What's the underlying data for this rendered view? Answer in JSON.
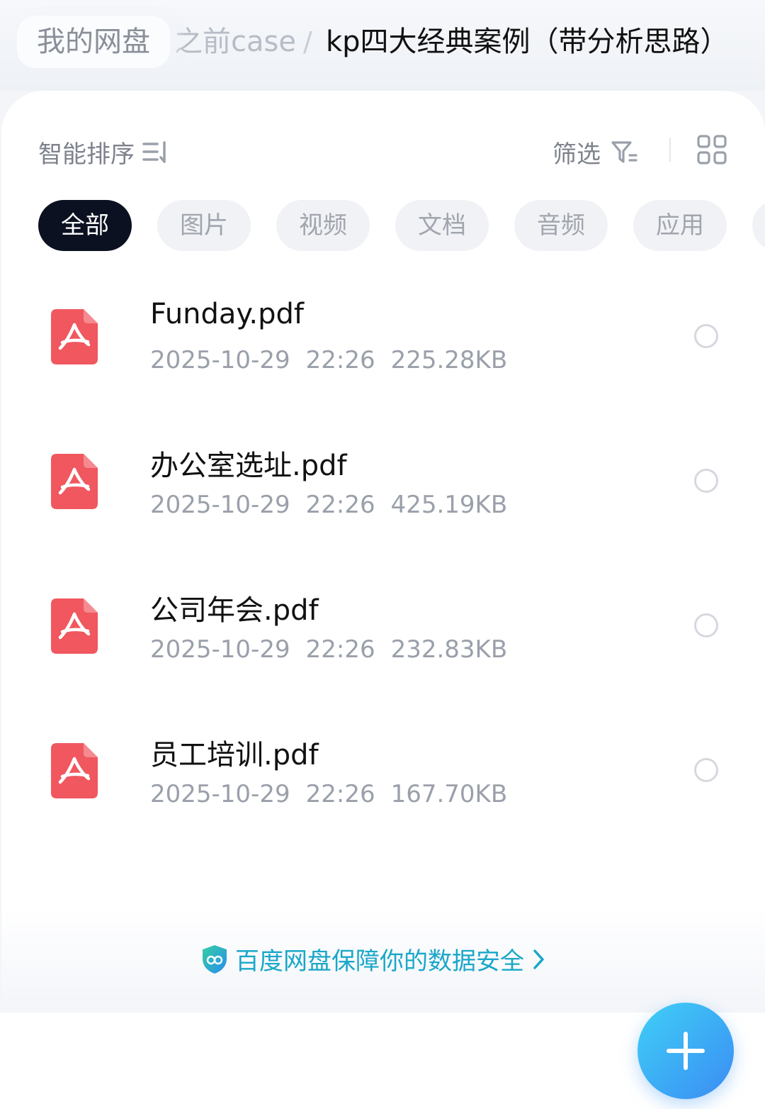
{
  "breadcrumb": {
    "root": "我的网盘",
    "parent": "之前case",
    "separator": "/",
    "current": "kp四大经典案例（带分析思路）"
  },
  "toolbar": {
    "sort_label": "智能排序",
    "sort_icon": "sort-icon",
    "filter_label": "筛选",
    "filter_icon": "filter-icon",
    "view_icon": "grid-view-icon"
  },
  "tabs": [
    {
      "label": "全部",
      "active": true
    },
    {
      "label": "图片",
      "active": false
    },
    {
      "label": "视频",
      "active": false
    },
    {
      "label": "文档",
      "active": false
    },
    {
      "label": "音频",
      "active": false
    },
    {
      "label": "应用",
      "active": false
    }
  ],
  "files": [
    {
      "name": "Funday.pdf",
      "date": "2025-10-29",
      "time": "22:26",
      "size": "225.28KB",
      "icon": "pdf-icon"
    },
    {
      "name": "办公室选址.pdf",
      "date": "2025-10-29",
      "time": "22:26",
      "size": "425.19KB",
      "icon": "pdf-icon"
    },
    {
      "name": "公司年会.pdf",
      "date": "2025-10-29",
      "time": "22:26",
      "size": "232.83KB",
      "icon": "pdf-icon"
    },
    {
      "name": "员工培训.pdf",
      "date": "2025-10-29",
      "time": "22:26",
      "size": "167.70KB",
      "icon": "pdf-icon"
    }
  ],
  "security": {
    "text": "百度网盘保障你的数据安全",
    "icon": "shield-icon"
  },
  "fab": {
    "icon": "plus-icon"
  },
  "colors": {
    "pdf": "#f0575f",
    "active_tab": "#0b1120",
    "security_text": "#1aa7c9",
    "fab_start": "#3fd0f6",
    "fab_end": "#3b8cf4"
  }
}
